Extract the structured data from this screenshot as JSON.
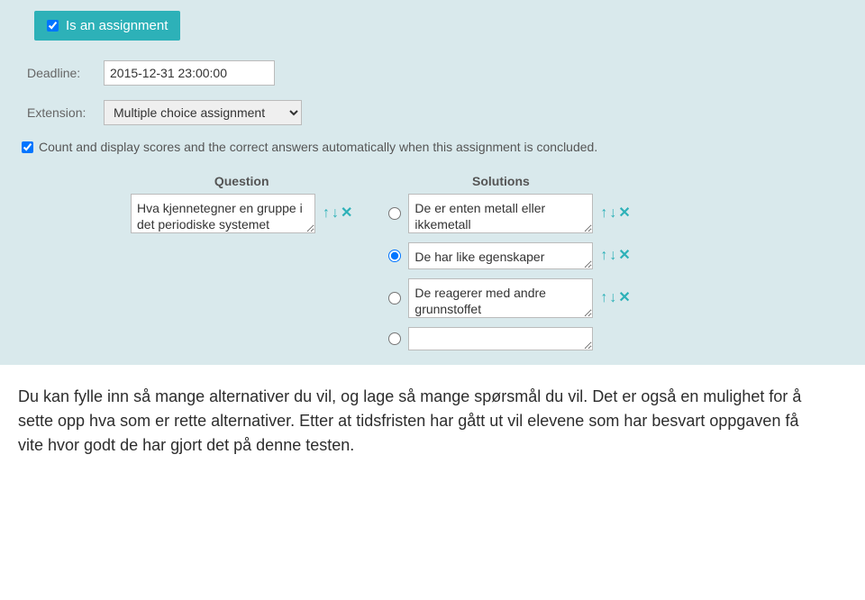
{
  "badge": {
    "label": "Is an assignment",
    "checked": true
  },
  "deadline": {
    "label": "Deadline:",
    "value": "2015-12-31 23:00:00"
  },
  "extension": {
    "label": "Extension:",
    "selected": "Multiple choice assignment"
  },
  "autoscore": {
    "label": "Count and display scores and the correct answers automatically when this assignment is concluded.",
    "checked": true
  },
  "headers": {
    "question": "Question",
    "solutions": "Solutions"
  },
  "question": {
    "text": "Hva kjennetegner en gruppe i det periodiske systemet"
  },
  "solutions": [
    {
      "text": "De er enten metall eller ikkemetall",
      "selected": false
    },
    {
      "text": "De har like egenskaper",
      "selected": true
    },
    {
      "text": "De reagerer med andre grunnstoffet",
      "selected": false
    },
    {
      "text": "",
      "selected": false
    }
  ],
  "description": "Du kan fylle inn så mange alternativer du vil, og lage så mange spørsmål du vil. Det er også en mulighet for å sette opp hva som er rette alternativer. Etter at tidsfristen har gått ut vil elevene som har besvart oppgaven få vite hvor godt de har gjort det på denne testen."
}
